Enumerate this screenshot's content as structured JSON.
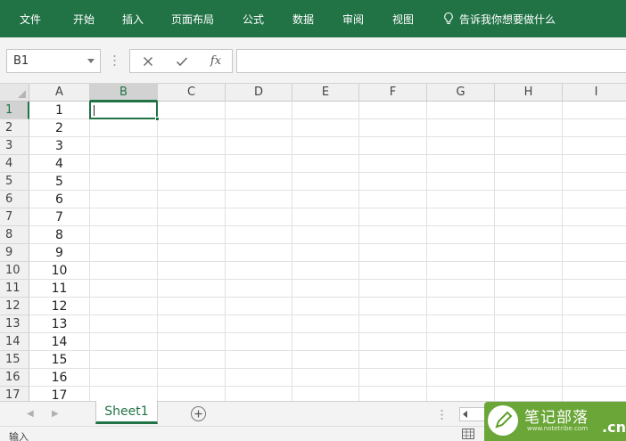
{
  "ribbon": {
    "tabs": [
      "文件",
      "开始",
      "插入",
      "页面布局",
      "公式",
      "数据",
      "审阅",
      "视图"
    ],
    "tell_me": "告诉我你想要做什么"
  },
  "formula_bar": {
    "name_box": "B1",
    "cancel_icon": "x-icon",
    "enter_icon": "check-icon",
    "function_label": "fx",
    "content": ""
  },
  "grid": {
    "columns": [
      "A",
      "B",
      "C",
      "D",
      "E",
      "F",
      "G",
      "H",
      "I"
    ],
    "rows": [
      "1",
      "2",
      "3",
      "4",
      "5",
      "6",
      "7",
      "8",
      "9",
      "10",
      "11",
      "12",
      "13",
      "14",
      "15",
      "16",
      "17"
    ],
    "column_a_values": [
      "1",
      "2",
      "3",
      "4",
      "5",
      "6",
      "7",
      "8",
      "9",
      "10",
      "11",
      "12",
      "13",
      "14",
      "15",
      "16",
      "17"
    ],
    "selected_cell": "B1",
    "selected_column": "B",
    "selected_row": "1"
  },
  "sheet_tabs": {
    "sheets": [
      "Sheet1"
    ],
    "active": "Sheet1",
    "add_icon": "plus-circle-icon"
  },
  "status_bar": {
    "mode": "输入"
  },
  "watermark": {
    "name": "笔记部落",
    "url": "www.notetribe.com",
    "suffix": ".cn"
  },
  "colors": {
    "accent": "#217346",
    "watermark_green": "#60a028"
  }
}
